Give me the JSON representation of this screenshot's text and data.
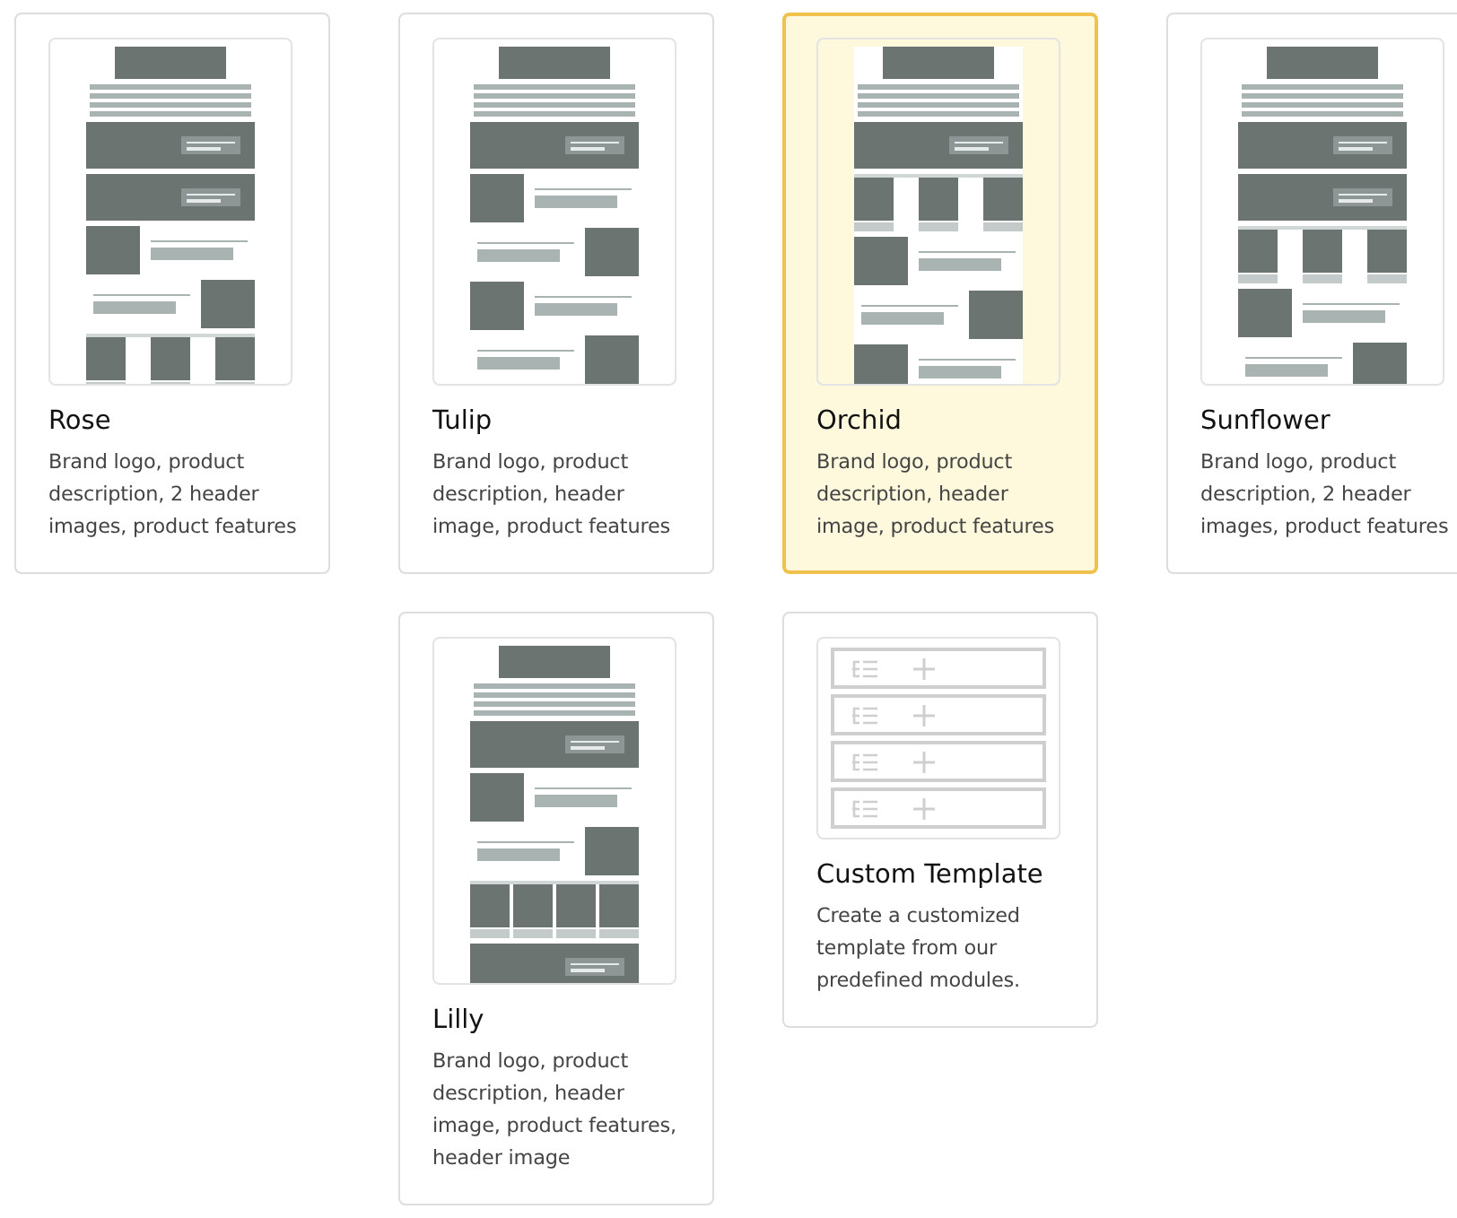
{
  "rows": [
    {
      "cards": [
        {
          "kind": "template",
          "title": "Rose",
          "description": "Brand logo, product description, 2 header images, product features",
          "selected": false,
          "modules": [
            {
              "kind": "logo"
            },
            {
              "kind": "text"
            },
            {
              "kind": "banner"
            },
            {
              "kind": "banner"
            },
            {
              "kind": "image-left"
            },
            {
              "kind": "image-right"
            },
            {
              "kind": "three-col"
            }
          ]
        },
        {
          "kind": "template",
          "title": "Tulip",
          "description": "Brand logo, product description, header image, product features",
          "selected": false,
          "modules": [
            {
              "kind": "logo"
            },
            {
              "kind": "text"
            },
            {
              "kind": "banner"
            },
            {
              "kind": "image-left"
            },
            {
              "kind": "image-right"
            },
            {
              "kind": "image-left"
            },
            {
              "kind": "image-right"
            }
          ]
        },
        {
          "kind": "template",
          "title": "Orchid",
          "description": "Brand logo, product description, header image, product features",
          "selected": true,
          "modules": [
            {
              "kind": "logo"
            },
            {
              "kind": "text"
            },
            {
              "kind": "banner"
            },
            {
              "kind": "three-col"
            },
            {
              "kind": "image-left"
            },
            {
              "kind": "image-right"
            },
            {
              "kind": "image-left"
            }
          ]
        },
        {
          "kind": "template",
          "title": "Sunflower",
          "description": "Brand logo, product description, 2 header images, product features",
          "selected": false,
          "modules": [
            {
              "kind": "logo"
            },
            {
              "kind": "text"
            },
            {
              "kind": "banner"
            },
            {
              "kind": "banner"
            },
            {
              "kind": "three-col"
            },
            {
              "kind": "image-left"
            },
            {
              "kind": "image-right"
            }
          ]
        }
      ]
    },
    {
      "cards": [
        {
          "kind": "template",
          "title": "Lilly",
          "description": "Brand logo, product description, header image, product features, header image",
          "selected": false,
          "modules": [
            {
              "kind": "logo"
            },
            {
              "kind": "text"
            },
            {
              "kind": "banner"
            },
            {
              "kind": "image-left"
            },
            {
              "kind": "image-right"
            },
            {
              "kind": "four-col"
            },
            {
              "kind": "banner"
            }
          ]
        },
        {
          "kind": "custom",
          "title": "Custom Template",
          "description": "Create a customized template from our predefined modules.",
          "selected": false,
          "slots": [
            {
              "kind": "module"
            },
            {
              "kind": "module"
            },
            {
              "kind": "module"
            },
            {
              "kind": "module"
            }
          ]
        }
      ]
    }
  ]
}
